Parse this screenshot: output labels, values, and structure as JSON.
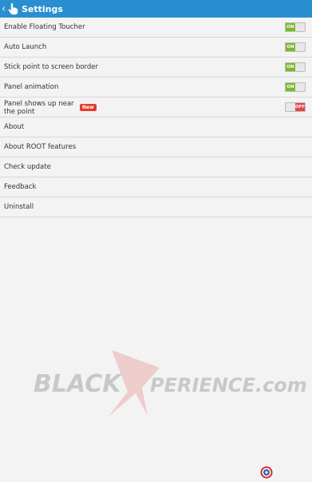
{
  "app": {
    "title": "Settings"
  },
  "icons": {
    "up": "back-chevron-icon",
    "app": "hand-pointer-icon",
    "floating": "floating-toucher-icon"
  },
  "colors": {
    "actionbar": "#2a8fd0",
    "toggle_on": "#7db72f",
    "toggle_off": "#e04848",
    "badge": "#e23c2c"
  },
  "settings": {
    "rows": [
      {
        "label": "Enable Floating Toucher",
        "toggle": "ON"
      },
      {
        "label": "Auto Launch",
        "toggle": "ON"
      },
      {
        "label": "Stick point to screen border",
        "toggle": "ON"
      },
      {
        "label": "Panel animation",
        "toggle": "ON"
      },
      {
        "label": "Panel shows up near the point",
        "badge": "New",
        "toggle": "OFF"
      },
      {
        "label": "About"
      },
      {
        "label": "About ROOT features"
      },
      {
        "label": "Check update"
      },
      {
        "label": "Feedback"
      },
      {
        "label": "Uninstall"
      }
    ]
  },
  "watermark": {
    "part1": "BLACK",
    "part2": "PERIENCE.com"
  }
}
